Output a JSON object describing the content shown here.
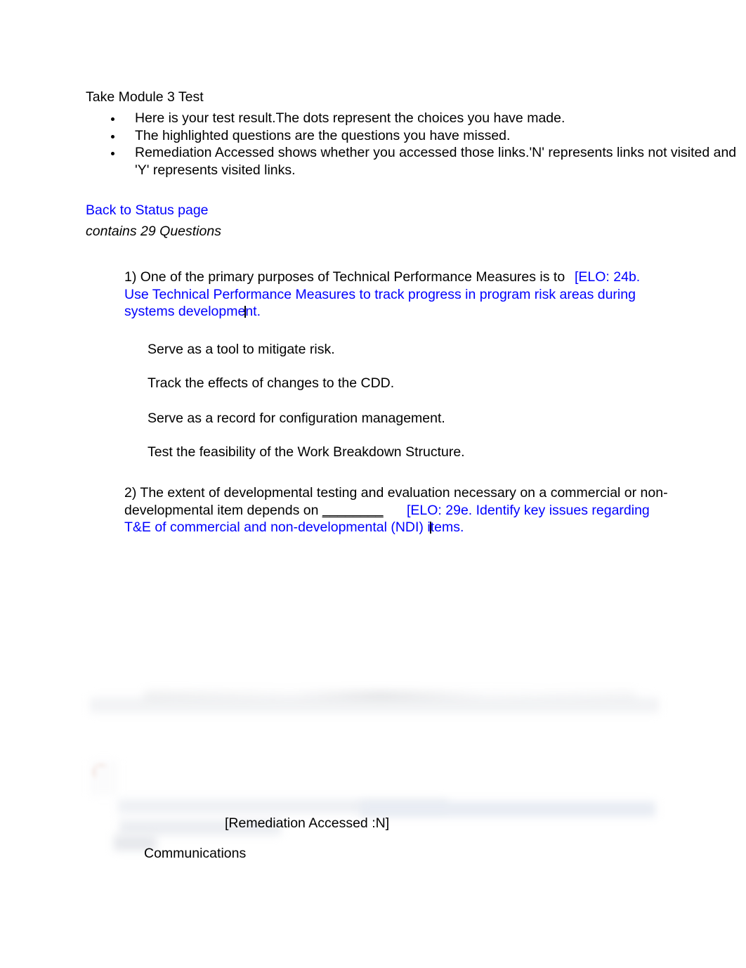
{
  "document": {
    "title": "Take Module 3 Test",
    "intro_bullets": [
      "Here is your test result.The dots represent the choices you have made.",
      "The highlighted questions are the questions you have missed.",
      "Remediation Accessed shows whether you accessed those links.'N' represents links not visited and 'Y' represents visited links."
    ],
    "back_link": "Back to Status page",
    "contains_line": "contains 29 Questions"
  },
  "questions": [
    {
      "number": "1)",
      "stem_black": "1) One of the primary purposes of Technical Performance Measures is to",
      "elo_overlay": "[ELO: 24b.",
      "elo_body_line1": "Use Technical Performance Measures to track progress in program risk areas during",
      "elo_body_line2a": "systems developme",
      "elo_body_line2b": "nt.",
      "choices": [
        "Serve as a tool to mitigate risk.",
        "Track the effects of changes to the CDD.",
        "Serve as a record for configuration management.",
        "Test the feasibility of the Work Breakdown Structure."
      ]
    },
    {
      "number": "2)",
      "stem_line1": "2) The extent of developmental testing and evaluation necessary on a commercial or non-",
      "stem_line2_pre": "developmental item depends on ",
      "stem_line2_blank": "________",
      "elo_overlay": "[ELO: 29e. Identify key issues regarding",
      "elo_body_line2a": "T&E of commercial and non-developmental (NDI) i",
      "elo_body_line2b": "tems.",
      "remediation_accessed": "[Remediation Accessed :N]",
      "choices": [
        "Communications"
      ]
    }
  ],
  "colors": {
    "link": "#0000ff",
    "text": "#000000",
    "page_background": "#ffffff",
    "highlight_row": "#f2f3f5",
    "marker_dot": "#c0512c"
  },
  "icons": {
    "selected_choice_marker": "selected-dot-icon",
    "bullet": "bullet-dot-icon"
  }
}
